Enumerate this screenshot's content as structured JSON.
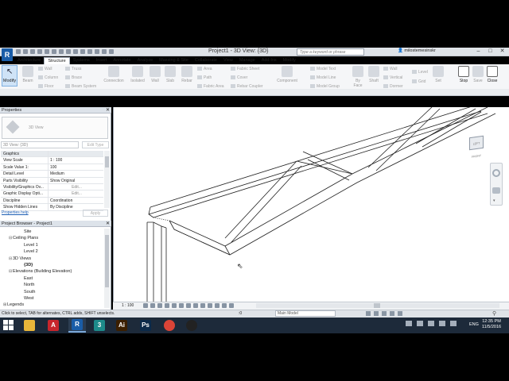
{
  "window": {
    "app_logo": "R",
    "title": "Project1 - 3D View: {3D}",
    "search_placeholder": "Type a keyword or phrase",
    "user": "milostemesinskr",
    "controls": [
      "–",
      "□",
      "✕"
    ]
  },
  "ribbon": {
    "tabs": [
      "Architecture",
      "Structure",
      "Systems",
      "Insert",
      "Annotate",
      "Analyze",
      "Massing & Site",
      "Collaborate",
      "View",
      "Manage",
      "Add-Ins",
      "Modify"
    ],
    "active_tab": "Structure",
    "modify_label": "Modify",
    "big_buttons": [
      "Beam",
      "Brace",
      "Connection",
      "Isolated",
      "Wall",
      "Slab",
      "Rebar",
      "Component",
      "By Face",
      "Shaft",
      "Set",
      "Stop",
      "Save",
      "Close"
    ],
    "small_buttons": {
      "wall": "Wall",
      "column": "Column",
      "floor": "Floor",
      "truss": "Truss",
      "brace_small": "Brace",
      "beam_system": "Beam System",
      "area": "Area",
      "path": "Path",
      "fabric_area": "Fabric Area",
      "fabric_sheet": "Fabric Sheet",
      "cover": "Cover",
      "rebar_coupler": "Rebar Coupler",
      "model_text": "Model Text",
      "model_line": "Model Line",
      "model_group": "Model Group",
      "wall_opening": "Wall",
      "vertical": "Vertical",
      "dormer": "Dormer",
      "level": "Level",
      "grid": "Grid"
    }
  },
  "properties": {
    "header": "Properties",
    "type_name": "3D View",
    "view_select": "3D View: {3D}",
    "edit_type": "Edit Type",
    "rows": [
      {
        "k": "Graphics",
        "v": "",
        "group": true
      },
      {
        "k": "View Scale",
        "v": "1 : 100"
      },
      {
        "k": "Scale Value    1:",
        "v": "100"
      },
      {
        "k": "Detail Level",
        "v": "Medium"
      },
      {
        "k": "Parts Visibility",
        "v": "Show Original"
      },
      {
        "k": "Visibility/Graphics Ov...",
        "v": "Edit...",
        "btn": true
      },
      {
        "k": "Graphic Display Opti...",
        "v": "Edit...",
        "btn": true
      },
      {
        "k": "Discipline",
        "v": "Coordination"
      },
      {
        "k": "Show Hidden Lines",
        "v": "By Discipline"
      }
    ],
    "help": "Properties help",
    "apply": "Apply"
  },
  "browser": {
    "header": "Project Browser - Project1",
    "tree": [
      {
        "label": "Site",
        "indent": 3,
        "tog": ""
      },
      {
        "label": "Ceiling Plans",
        "indent": 1,
        "tog": "−"
      },
      {
        "label": "Level 1",
        "indent": 3,
        "tog": ""
      },
      {
        "label": "Level 2",
        "indent": 3,
        "tog": ""
      },
      {
        "label": "3D Views",
        "indent": 1,
        "tog": "−"
      },
      {
        "label": "{3D}",
        "indent": 3,
        "tog": "",
        "bold": true
      },
      {
        "label": "Elevations (Building Elevation)",
        "indent": 1,
        "tog": "−"
      },
      {
        "label": "East",
        "indent": 3,
        "tog": ""
      },
      {
        "label": "North",
        "indent": 3,
        "tog": ""
      },
      {
        "label": "South",
        "indent": 3,
        "tog": ""
      },
      {
        "label": "West",
        "indent": 3,
        "tog": ""
      },
      {
        "label": "Legends",
        "indent": 0,
        "tog": "+"
      }
    ]
  },
  "viewport": {
    "viewcube_label": "LEFT FRONT",
    "scale": "1 : 100"
  },
  "status": {
    "text": "Click to select, TAB for alternates, CTRL adds, SHIFT unselects.",
    "worksets": ":0",
    "model": "Main Model"
  },
  "taskbar": {
    "apps": [
      {
        "name": "file-explorer",
        "glyph": "",
        "color": "#e8b63a"
      },
      {
        "name": "autodesk",
        "glyph": "A",
        "color": "#c8252c"
      },
      {
        "name": "revit",
        "glyph": "R",
        "color": "#1a5da8"
      },
      {
        "name": "3ds-max",
        "glyph": "3",
        "color": "#1d8a8a"
      },
      {
        "name": "illustrator",
        "glyph": "Ai",
        "color": "#3b1f00"
      },
      {
        "name": "photoshop",
        "glyph": "Ps",
        "color": "#0b2a4a"
      },
      {
        "name": "chrome",
        "glyph": "",
        "color": "#db4437"
      },
      {
        "name": "obs",
        "glyph": "",
        "color": "#222"
      }
    ],
    "lang": "ENG",
    "time": "12:35 PM",
    "date": "11/5/2016"
  }
}
